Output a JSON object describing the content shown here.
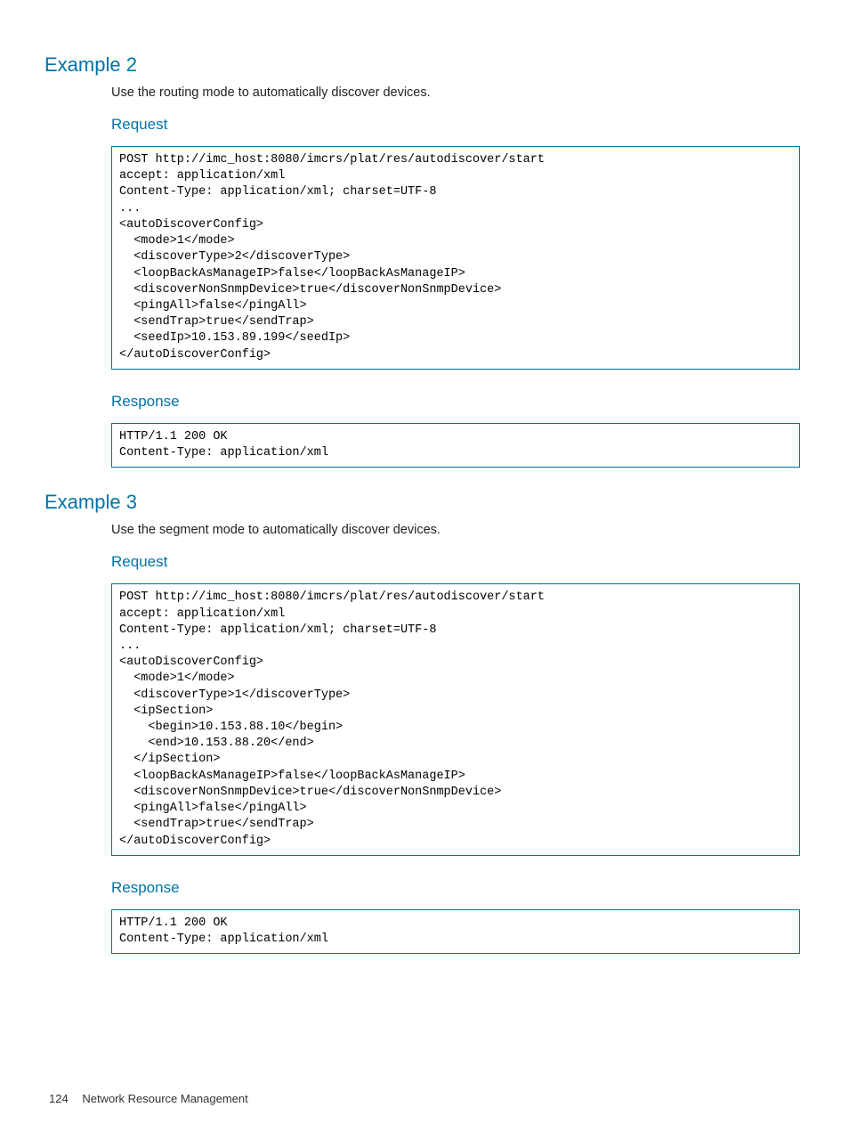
{
  "example2": {
    "heading": "Example 2",
    "description": "Use the routing mode to automatically discover devices.",
    "request_label": "Request",
    "request_code": "POST http://imc_host:8080/imcrs/plat/res/autodiscover/start\naccept: application/xml\nContent-Type: application/xml; charset=UTF-8\n...\n<autoDiscoverConfig>\n  <mode>1</mode>\n  <discoverType>2</discoverType>\n  <loopBackAsManageIP>false</loopBackAsManageIP>\n  <discoverNonSnmpDevice>true</discoverNonSnmpDevice>\n  <pingAll>false</pingAll>\n  <sendTrap>true</sendTrap>\n  <seedIp>10.153.89.199</seedIp>\n</autoDiscoverConfig>",
    "response_label": "Response",
    "response_code": "HTTP/1.1 200 OK\nContent-Type: application/xml"
  },
  "example3": {
    "heading": "Example 3",
    "description": "Use the segment mode to automatically discover devices.",
    "request_label": "Request",
    "request_code": "POST http://imc_host:8080/imcrs/plat/res/autodiscover/start\naccept: application/xml\nContent-Type: application/xml; charset=UTF-8\n...\n<autoDiscoverConfig>\n  <mode>1</mode>\n  <discoverType>1</discoverType>\n  <ipSection>\n    <begin>10.153.88.10</begin>\n    <end>10.153.88.20</end>\n  </ipSection>\n  <loopBackAsManageIP>false</loopBackAsManageIP>\n  <discoverNonSnmpDevice>true</discoverNonSnmpDevice>\n  <pingAll>false</pingAll>\n  <sendTrap>true</sendTrap>\n</autoDiscoverConfig>",
    "response_label": "Response",
    "response_code": "HTTP/1.1 200 OK\nContent-Type: application/xml"
  },
  "footer": {
    "page_number": "124",
    "section_title": "Network Resource Management"
  }
}
